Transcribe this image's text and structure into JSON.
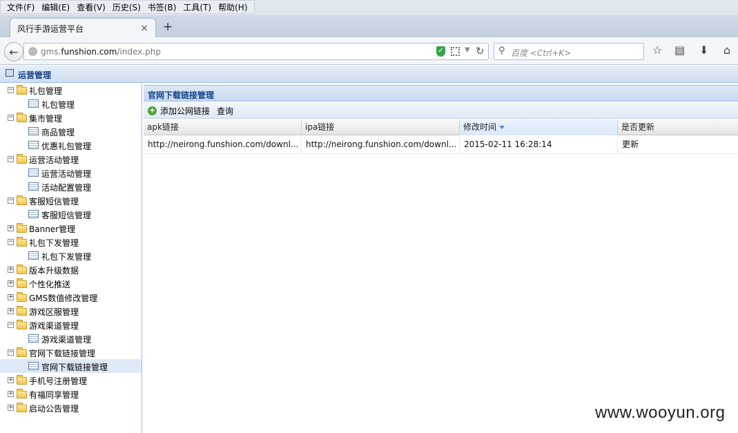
{
  "browser": {
    "menus": [
      "文件(F)",
      "编辑(E)",
      "查看(V)",
      "历史(S)",
      "书签(B)",
      "工具(T)",
      "帮助(H)"
    ],
    "tab_title": "风行手游运营平台",
    "url_prefix": "gms.",
    "url_domain": "funshion.com",
    "url_path": "/index.php",
    "search_placeholder": "百度 <Ctrl+K>"
  },
  "app": {
    "header_title": "运营管理"
  },
  "sidebar": {
    "items": [
      {
        "label": "礼包管理",
        "type": "folder",
        "expanded": true
      },
      {
        "label": "礼包管理",
        "type": "leaf"
      },
      {
        "label": "集市管理",
        "type": "folder",
        "expanded": true
      },
      {
        "label": "商品管理",
        "type": "leaf"
      },
      {
        "label": "优惠礼包管理",
        "type": "leaf"
      },
      {
        "label": "运营活动管理",
        "type": "folder",
        "expanded": true
      },
      {
        "label": "运营活动管理",
        "type": "leaf"
      },
      {
        "label": "活动配置管理",
        "type": "leaf"
      },
      {
        "label": "客服短信管理",
        "type": "folder",
        "expanded": true
      },
      {
        "label": "客服短信管理",
        "type": "leaf"
      },
      {
        "label": "Banner管理",
        "type": "folder",
        "expanded": false
      },
      {
        "label": "礼包下发管理",
        "type": "folder",
        "expanded": true
      },
      {
        "label": "礼包下发管理",
        "type": "leaf"
      },
      {
        "label": "版本升级数据",
        "type": "folder",
        "expanded": false
      },
      {
        "label": "个性化推送",
        "type": "folder",
        "expanded": false
      },
      {
        "label": "GMS数值修改管理",
        "type": "folder",
        "expanded": false
      },
      {
        "label": "游戏区服管理",
        "type": "folder",
        "expanded": false
      },
      {
        "label": "游戏渠道管理",
        "type": "folder",
        "expanded": true
      },
      {
        "label": "游戏渠道管理",
        "type": "leaf"
      },
      {
        "label": "官网下载链接管理",
        "type": "folder",
        "expanded": true
      },
      {
        "label": "官网下载链接管理",
        "type": "leaf",
        "selected": true
      },
      {
        "label": "手机号注册管理",
        "type": "folder",
        "expanded": false
      },
      {
        "label": "有福同享管理",
        "type": "folder",
        "expanded": false
      },
      {
        "label": "启动公告管理",
        "type": "folder",
        "expanded": false
      }
    ]
  },
  "main": {
    "panel_title": "官网下载链接管理",
    "toolbar": {
      "add_label": "添加公网链接",
      "query_label": "查询"
    },
    "columns": [
      "apk链接",
      "ipa链接",
      "修改时间",
      "是否更新"
    ],
    "sorted_column": "修改时间",
    "rows": [
      [
        "http://neirong.funshion.com/downl...",
        "http://neirong.funshion.com/downl...",
        "2015-02-11 16:28:14",
        "更新"
      ]
    ]
  },
  "watermark": "www.wooyun.org"
}
